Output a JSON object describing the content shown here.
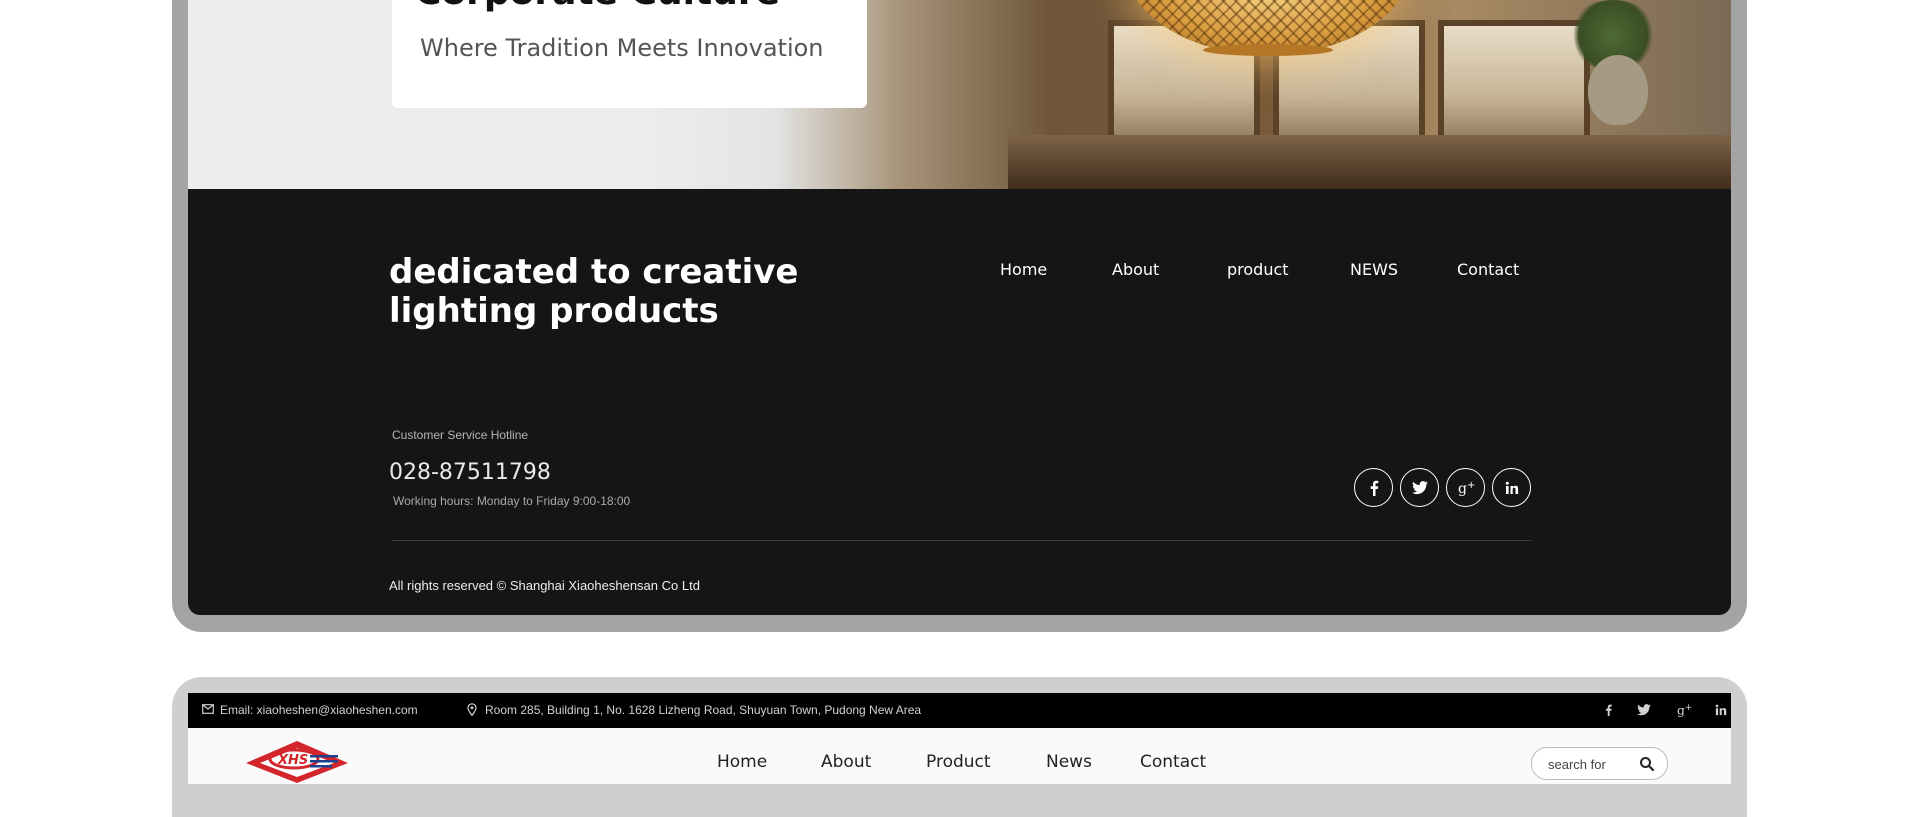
{
  "hero": {
    "title": "Corporate Culture",
    "subtitle": "Where Tradition Meets Innovation"
  },
  "footer": {
    "tagline": "dedicated to creative lighting products",
    "nav": [
      "Home",
      "About",
      "product",
      "NEWS",
      "Contact"
    ],
    "hotline_label": "Customer Service Hotline",
    "hotline_number": "028-87511798",
    "working_hours": "Working hours: Monday to Friday 9:00-18:00",
    "socials": [
      "facebook-icon",
      "twitter-icon",
      "google-plus-icon",
      "linkedin-icon"
    ],
    "copyright": "All rights reserved © Shanghai Xiaoheshensan Co Ltd"
  },
  "header2": {
    "email": "Email: xiaoheshen@xiaoheshen.com",
    "address": "Room 285, Building 1, No. 1628 Lizheng Road, Shuyuan Town, Pudong New Area",
    "socials": [
      "facebook-icon",
      "twitter-icon",
      "google-plus-icon",
      "linkedin-icon"
    ],
    "logo_text": "XHS",
    "nav": [
      "Home",
      "About",
      "Product",
      "News",
      "Contact"
    ],
    "search_placeholder": "search for"
  },
  "colors": {
    "footer_bg": "#151515",
    "frame_gray": "#a4a4a4",
    "logo_red": "#d3262c",
    "logo_blue": "#1f3f8f"
  }
}
